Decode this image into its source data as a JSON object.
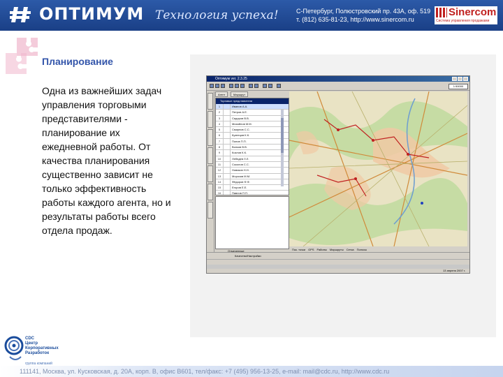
{
  "header": {
    "brand": "ОПТИМУМ",
    "slogan": "Технология успеха!",
    "contact_line1": "С-Петербург, Полюстровский пр. 43А, оф. 519",
    "contact_line2": "т. (812) 635-81-23, http://www.sinercom.ru",
    "partner_name": "Sinercom",
    "partner_sub": "Система управления продажами"
  },
  "slide": {
    "title": "Планирование",
    "body": "Одна из важнейших задач управления торговыми представителями - планирование их ежедневной работы. От качества планирования существенно зависит не только эффективность работы каждого агента, но и результаты работы всего отдела продаж."
  },
  "app": {
    "window_title": "Оптимум ver. 2.3.25",
    "zoom": "1:50000",
    "list_header": "Торговые представители",
    "tabs": [
      "Агент",
      "Маршрут"
    ],
    "rows": [
      {
        "num": "1",
        "name": "Иванов А.А."
      },
      {
        "num": "2",
        "name": "Петров А.Е."
      },
      {
        "num": "3",
        "name": "Сидоров В.В."
      },
      {
        "num": "4",
        "name": "Михайлов М.М."
      },
      {
        "num": "5",
        "name": "Смирнов С.С."
      },
      {
        "num": "6",
        "name": "Кузнецов К.К."
      },
      {
        "num": "7",
        "name": "Попов П.П."
      },
      {
        "num": "8",
        "name": "Волков В.В."
      },
      {
        "num": "9",
        "name": "Козлов К.К."
      },
      {
        "num": "10",
        "name": "Лебедев Л.Л."
      },
      {
        "num": "11",
        "name": "Соколов С.С."
      },
      {
        "num": "12",
        "name": "Новиков Н.Н."
      },
      {
        "num": "13",
        "name": "Морозов М.М."
      },
      {
        "num": "14",
        "name": "Фёдоров Ф.Ф."
      },
      {
        "num": "15",
        "name": "Егоров Е.Е."
      },
      {
        "num": "16",
        "name": "Павлов П.П."
      },
      {
        "num": "17",
        "name": "Семёнов С.С."
      }
    ],
    "otm_label": "Отмеченные",
    "map_bottom": [
      "Пок. точки",
      "GPS",
      "Районы",
      "Маршруты",
      "Сетка",
      "Полосы"
    ],
    "bottom_bar": "Качество/Настройки",
    "date": "13 апреля 2007 г."
  },
  "footer": {
    "cdc_name": "CDC",
    "cdc_line1": "Центр",
    "cdc_line2": "Корпоративных",
    "cdc_line3": "Разработок",
    "cdc_sub": "группа компаний",
    "address": "111141, Москва, ул. Кусковская, д. 20А, корп. В, офис В601, тел/факс: +7 (495) 956-13-25, e-mail: mail@cdc.ru, http://www.cdc.ru"
  }
}
